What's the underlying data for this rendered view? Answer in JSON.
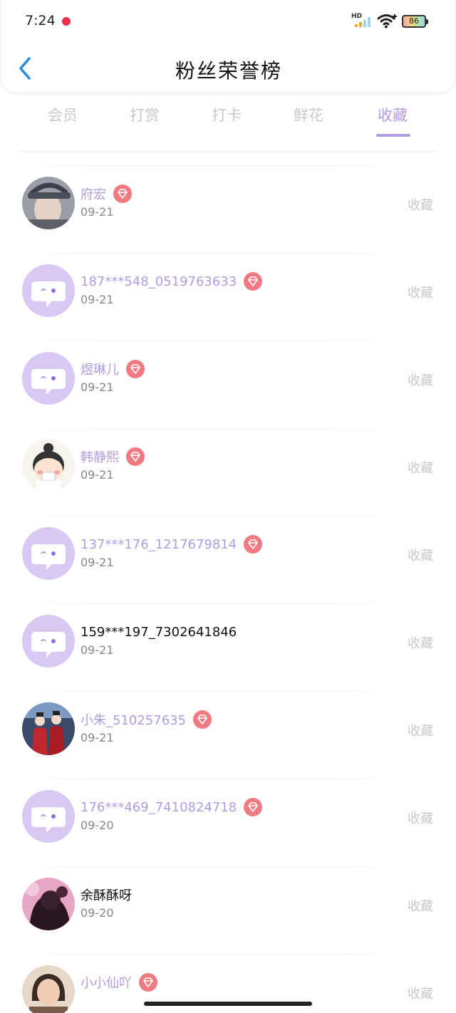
{
  "status_bar": {
    "time": "7:24",
    "network": "HD",
    "battery": "86"
  },
  "header": {
    "title": "粉丝荣誉榜"
  },
  "tabs": [
    {
      "label": "会员",
      "active": false
    },
    {
      "label": "打赏",
      "active": false
    },
    {
      "label": "打卡",
      "active": false
    },
    {
      "label": "鲜花",
      "active": false
    },
    {
      "label": "收藏",
      "active": true
    }
  ],
  "colors": {
    "accent": "#b39be0",
    "badge": "#f07a82",
    "muted": "#c8c8c8"
  },
  "fans": [
    {
      "name": "府宏",
      "date": "09-21",
      "action": "收藏",
      "vip": true,
      "avatar": "photo-man-cap-icon"
    },
    {
      "name": "187***548_0519763633",
      "date": "09-21",
      "action": "收藏",
      "vip": true,
      "avatar": "default-chat-avatar-icon"
    },
    {
      "name": "煜琳儿",
      "date": "09-21",
      "action": "收藏",
      "vip": true,
      "avatar": "default-chat-avatar-icon"
    },
    {
      "name": "韩静熙",
      "date": "09-21",
      "action": "收藏",
      "vip": true,
      "avatar": "cartoon-kid-icon"
    },
    {
      "name": "137***176_1217679814",
      "date": "09-21",
      "action": "收藏",
      "vip": true,
      "avatar": "default-chat-avatar-icon"
    },
    {
      "name": "159***197_7302641846",
      "date": "09-21",
      "action": "收藏",
      "vip": false,
      "avatar": "default-chat-avatar-icon"
    },
    {
      "name": "小朱_510257635",
      "date": "09-21",
      "action": "收藏",
      "vip": true,
      "avatar": "photo-two-figures-red-icon"
    },
    {
      "name": "176***469_7410824718",
      "date": "09-20",
      "action": "收藏",
      "vip": true,
      "avatar": "default-chat-avatar-icon"
    },
    {
      "name": "余酥酥呀",
      "date": "09-20",
      "action": "收藏",
      "vip": false,
      "avatar": "photo-dark-pink-icon"
    },
    {
      "name": "小小仙吖",
      "date": "",
      "action": "收藏",
      "vip": true,
      "avatar": "photo-woman-icon"
    }
  ]
}
